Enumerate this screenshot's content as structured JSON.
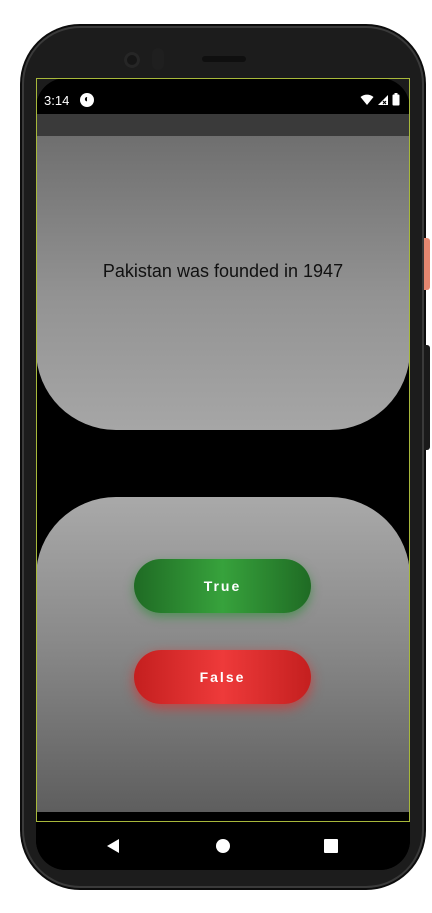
{
  "status_bar": {
    "time": "3:14",
    "app_icon_glyph": "◐",
    "icons": [
      "wifi-icon",
      "signal-icon",
      "battery-icon"
    ]
  },
  "quiz": {
    "question": "Pakistan was founded in 1947",
    "true_label": "True",
    "false_label": "False"
  },
  "colors": {
    "true_button": "#2e8b33",
    "false_button": "#e53535",
    "card_gray": "#8f8f8f",
    "frame_outline": "#a7b83a"
  },
  "nav_bar": {
    "icons": [
      "back-icon",
      "home-icon",
      "recents-icon"
    ]
  }
}
